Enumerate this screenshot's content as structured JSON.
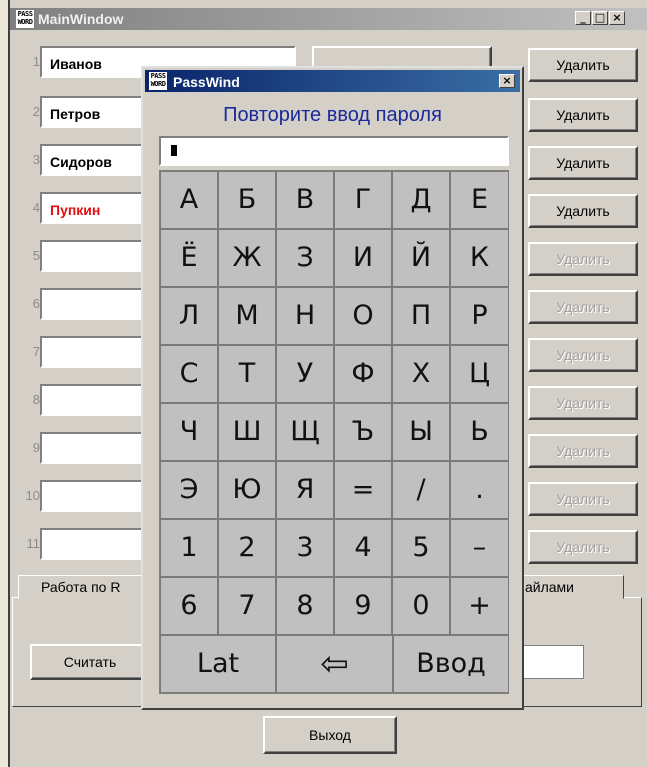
{
  "main_window": {
    "title": "MainWindow",
    "logo_text": "PASS WORD",
    "rows": [
      {
        "num": "1",
        "name": "Иванов",
        "delete": "Удалить",
        "enabled": true
      },
      {
        "num": "2",
        "name": "Петров",
        "delete": "Удалить",
        "enabled": true
      },
      {
        "num": "3",
        "name": "Сидоров",
        "delete": "Удалить",
        "enabled": true
      },
      {
        "num": "4",
        "name": "Пупкин",
        "delete": "Удалить",
        "enabled": true,
        "color": "#e01010"
      },
      {
        "num": "5",
        "name": "",
        "delete": "Удалить",
        "enabled": false
      },
      {
        "num": "6",
        "name": "",
        "delete": "Удалить",
        "enabled": false
      },
      {
        "num": "7",
        "name": "",
        "delete": "Удалить",
        "enabled": false
      },
      {
        "num": "8",
        "name": "",
        "delete": "Удалить",
        "enabled": false
      },
      {
        "num": "9",
        "name": "",
        "delete": "Удалить",
        "enabled": false
      },
      {
        "num": "10",
        "name": "",
        "delete": "Удалить",
        "enabled": false
      },
      {
        "num": "11",
        "name": "",
        "delete": "Удалить",
        "enabled": false
      }
    ],
    "tabs": [
      "Работа по R",
      "айлами"
    ],
    "read_button": "Считать",
    "exit_button": "Выход"
  },
  "dialog": {
    "title": "PassWind",
    "logo_text": "PASS WORD",
    "prompt": "Повторите ввод пароля",
    "password_value": "",
    "keys": [
      [
        "А",
        "Б",
        "В",
        "Г",
        "Д",
        "Е"
      ],
      [
        "Ё",
        "Ж",
        "З",
        "И",
        "Й",
        "К"
      ],
      [
        "Л",
        "М",
        "Н",
        "О",
        "П",
        "Р"
      ],
      [
        "С",
        "Т",
        "У",
        "Ф",
        "Х",
        "Ц"
      ],
      [
        "Ч",
        "Ш",
        "Щ",
        "Ъ",
        "Ы",
        "Ь"
      ],
      [
        "Э",
        "Ю",
        "Я",
        "=",
        "/",
        "."
      ],
      [
        "1",
        "2",
        "3",
        "4",
        "5",
        "–"
      ],
      [
        "6",
        "7",
        "8",
        "9",
        "0",
        "+"
      ]
    ],
    "bottom_keys": {
      "lat": "Lat",
      "backspace": "⇦",
      "enter": "Ввод"
    }
  },
  "colors": {
    "prompt": "#1a2a9c",
    "highlight_name": "#e01010",
    "titlebar_active": "#0a246a"
  }
}
